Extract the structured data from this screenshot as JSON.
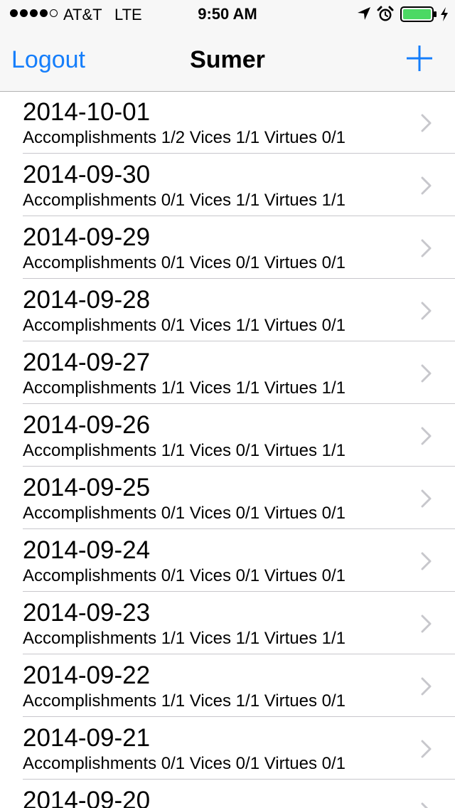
{
  "status_bar": {
    "carrier": "AT&T",
    "network": "LTE",
    "time": "9:50 AM",
    "signal_bars_filled": 4,
    "signal_bars_total": 5,
    "icons": [
      "location-arrow-icon",
      "alarm-clock-icon",
      "battery-icon",
      "charging-bolt-icon"
    ],
    "battery_level": 1.0,
    "battery_color": "#4cd964"
  },
  "nav_bar": {
    "left_button": "Logout",
    "title": "Sumer",
    "right_button_icon": "plus-icon",
    "tint_color": "#157efb"
  },
  "list": {
    "rows": [
      {
        "date": "2014-10-01",
        "summary": "Accomplishments 1/2 Vices 1/1 Virtues 0/1"
      },
      {
        "date": "2014-09-30",
        "summary": "Accomplishments 0/1 Vices 1/1 Virtues 1/1"
      },
      {
        "date": "2014-09-29",
        "summary": "Accomplishments 0/1 Vices 0/1 Virtues 0/1"
      },
      {
        "date": "2014-09-28",
        "summary": "Accomplishments 0/1 Vices 1/1 Virtues 0/1"
      },
      {
        "date": "2014-09-27",
        "summary": "Accomplishments 1/1 Vices 1/1 Virtues 1/1"
      },
      {
        "date": "2014-09-26",
        "summary": "Accomplishments 1/1 Vices 0/1 Virtues 1/1"
      },
      {
        "date": "2014-09-25",
        "summary": "Accomplishments 0/1 Vices 0/1 Virtues 0/1"
      },
      {
        "date": "2014-09-24",
        "summary": "Accomplishments 0/1 Vices 0/1 Virtues 0/1"
      },
      {
        "date": "2014-09-23",
        "summary": "Accomplishments 1/1 Vices 1/1 Virtues 1/1"
      },
      {
        "date": "2014-09-22",
        "summary": "Accomplishments 1/1 Vices 1/1 Virtues 0/1"
      },
      {
        "date": "2014-09-21",
        "summary": "Accomplishments 0/1 Vices 0/1 Virtues 0/1"
      },
      {
        "date": "2014-09-20",
        "summary": ""
      }
    ]
  }
}
